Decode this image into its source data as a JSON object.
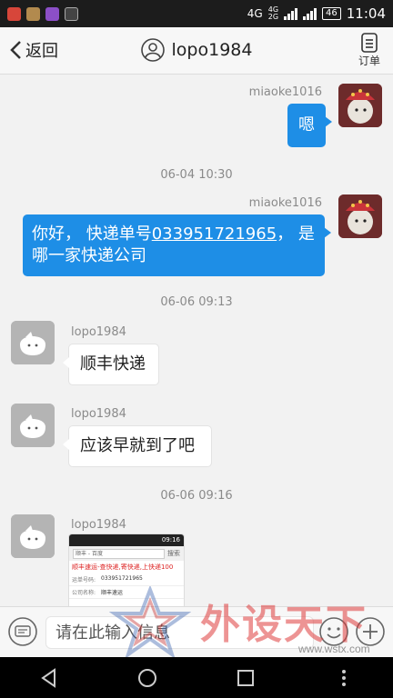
{
  "status_bar": {
    "network_label": "4G",
    "network_label_2": "4G",
    "network_label_3": "2G",
    "battery": "46",
    "time": "11:04"
  },
  "header": {
    "back_label": "返回",
    "title": "lopo1984",
    "order_label": "订单"
  },
  "messages": [
    {
      "sender": "miaoke1016",
      "text": "嗯"
    },
    {
      "timestamp": "06-04 10:30"
    },
    {
      "sender": "miaoke1016",
      "text_pre": "你好， 快递单号",
      "link": "033951721965",
      "text_post": "， 是哪一家快递公司"
    },
    {
      "timestamp": "06-06 09:13"
    },
    {
      "sender": "lopo1984",
      "text": "顺丰快递"
    },
    {
      "sender": "lopo1984",
      "text": "应该早就到了吧"
    },
    {
      "timestamp": "06-06 09:16"
    },
    {
      "sender": "lopo1984",
      "image": {
        "status_time": "09:16",
        "url_text": "顺丰 - 百度",
        "search_label": "搜索",
        "headline": "顺丰速运-查快递,寄快递,上快递100",
        "row1_label": "运单号码:",
        "row1_value": "033951721965",
        "row2_label": "公司名称:",
        "row2_value": "顺丰速运"
      }
    }
  ],
  "input_bar": {
    "placeholder": "请在此输入信息"
  },
  "watermark": {
    "text": "外设天下",
    "url": "www.wstx.com"
  },
  "colors": {
    "bubble_out": "#1e8ee6",
    "bubble_in": "#ffffff",
    "background": "#f2f2f2"
  }
}
